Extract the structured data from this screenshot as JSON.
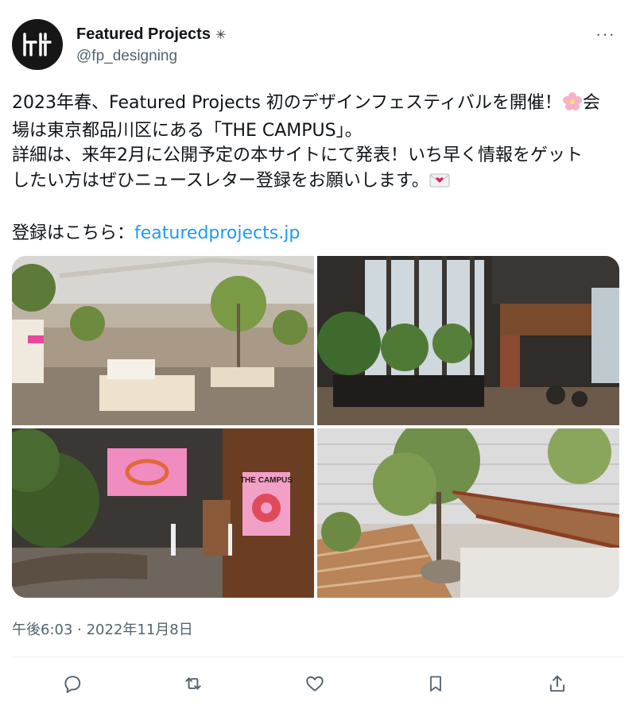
{
  "author": {
    "display_name": "Featured Projects",
    "badge": "✳",
    "handle": "@fp_designing",
    "avatar_text": "卄"
  },
  "menu": {
    "more_label": "···"
  },
  "tweet": {
    "line1": "2023年春、Featured Projects 初のデザインフェスティバルを開催！",
    "line1_tail": "会",
    "line2": "場は東京都品川区にある「THE CAMPUS」。",
    "line3": "詳細は、来年2月に公開予定の本サイトにて発表！いち早く情報をゲット",
    "line4": "したい方はぜひニュースレター登録をお願いします。",
    "line6_prefix": "登録はこちら：",
    "link_text": "featuredprojects.jp",
    "emoji_1": "cherry-blossom",
    "emoji_2": "love-letter"
  },
  "media": {
    "photos": [
      {
        "description_icon": "photo-office-interior"
      },
      {
        "description_icon": "photo-lounge-windows"
      },
      {
        "description_icon": "photo-gallery-space"
      },
      {
        "description_icon": "photo-outdoor-terrace"
      }
    ],
    "poster_text": "THE CAMPUS"
  },
  "meta": {
    "timestamp": "午後6:03 · 2022年11月8日"
  },
  "actions": [
    "reply-icon",
    "retweet-icon",
    "like-icon",
    "bookmark-icon",
    "share-icon"
  ],
  "colors": {
    "link": "#1d9bf0",
    "secondary_text": "#536471",
    "divider": "#eff3f4"
  }
}
